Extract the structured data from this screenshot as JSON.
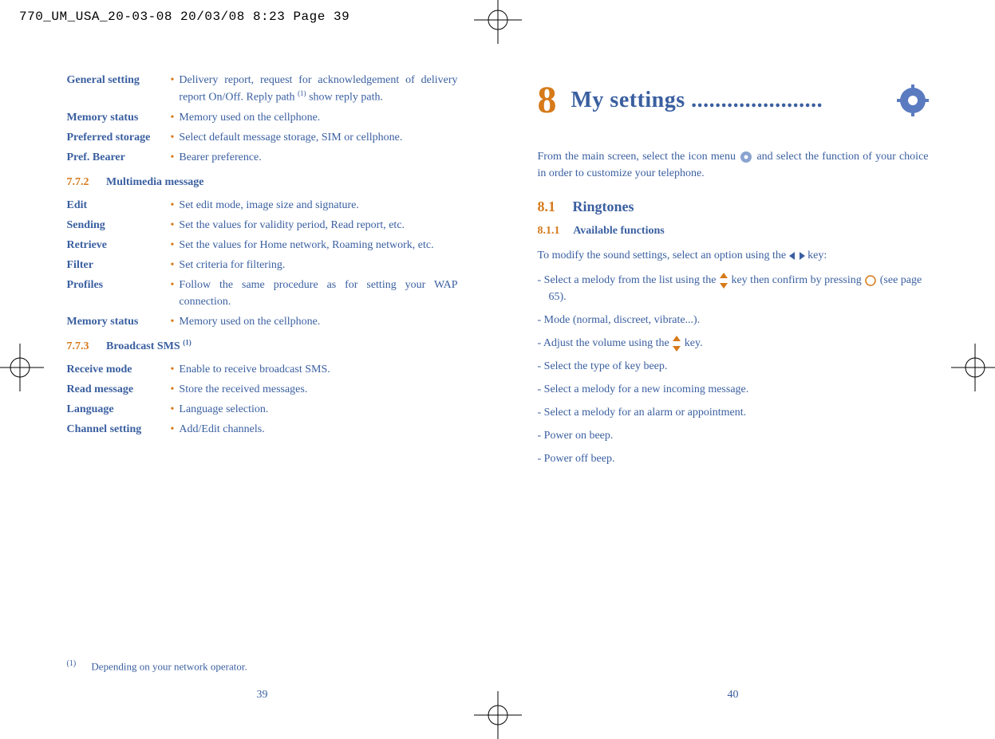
{
  "slug": "770_UM_USA_20-03-08  20/03/08  8:23  Page 39",
  "left_page": {
    "definitions_1": [
      {
        "term": "General setting",
        "desc_pre": "Delivery report, request for acknowledgement of delivery report On/Off. Reply path ",
        "sup": "(1)",
        "desc_post": " show reply path."
      },
      {
        "term": "Memory status",
        "desc": "Memory used on the cellphone."
      },
      {
        "term": "Preferred storage",
        "desc": "Select default message storage, SIM or cellphone."
      },
      {
        "term": "Pref. Bearer",
        "desc": "Bearer preference."
      }
    ],
    "section_772": {
      "num": "7.7.2",
      "title": "Multimedia message"
    },
    "definitions_2": [
      {
        "term": "Edit",
        "desc": "Set edit mode, image size and signature."
      },
      {
        "term": "Sending",
        "desc": "Set the values for validity period, Read report, etc."
      },
      {
        "term": "Retrieve",
        "desc": "Set the values for Home network, Roaming network, etc."
      },
      {
        "term": "Filter",
        "desc": "Set criteria for filtering."
      },
      {
        "term": "Profiles",
        "desc": "Follow the same procedure as for setting your WAP connection."
      },
      {
        "term": "Memory status",
        "desc": "Memory used on the cellphone."
      }
    ],
    "section_773": {
      "num": "7.7.3",
      "title_pre": "Broadcast SMS ",
      "title_sup": "(1)"
    },
    "definitions_3": [
      {
        "term": "Receive mode",
        "desc": "Enable to receive broadcast SMS."
      },
      {
        "term": "Read message",
        "desc": "Store the received messages."
      },
      {
        "term": "Language",
        "desc": "Language selection."
      },
      {
        "term": "Channel setting",
        "desc": "Add/Edit channels."
      }
    ],
    "footnote": {
      "sup": "(1)",
      "text": "Depending on your network operator."
    },
    "page_number": "39"
  },
  "right_page": {
    "chapter_num": "8",
    "chapter_title": "My settings ......................",
    "intro_pre": "From the main screen, select the icon menu ",
    "intro_post": " and select the function of your choice in order to customize your telephone.",
    "section_81": {
      "num": "8.1",
      "title": "Ringtones"
    },
    "section_811": {
      "num": "8.1.1",
      "title": "Available functions"
    },
    "para_pre": "To modify the sound settings, select an option using the ",
    "para_post": " key:",
    "items": [
      {
        "pre": "Select a melody from the list using the ",
        "mid": " key then confirm by pressing ",
        "post": " (see page 65).",
        "has_updown": true,
        "has_circle": true
      },
      {
        "text": "Mode (normal, discreet, vibrate...)."
      },
      {
        "pre": "Adjust the volume using the ",
        "post": " key.",
        "has_updown": true
      },
      {
        "text": "Select the type of key beep."
      },
      {
        "text": "Select a melody for a new incoming message."
      },
      {
        "text": "Select a melody for an alarm or appointment."
      },
      {
        "text": "Power on beep."
      },
      {
        "text": "Power off beep."
      }
    ],
    "page_number": "40"
  }
}
